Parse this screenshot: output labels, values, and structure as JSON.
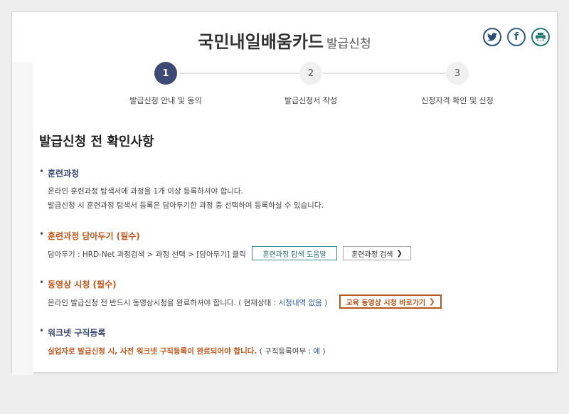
{
  "header": {
    "title": "국민내일배움카드",
    "subtitle": "발급신청"
  },
  "social": [
    "twitter-icon",
    "facebook-icon",
    "print-icon"
  ],
  "steps": [
    {
      "num": "1",
      "label": "발급신청 안내 및 동의"
    },
    {
      "num": "2",
      "label": "발급신청서 작성"
    },
    {
      "num": "3",
      "label": "신청자격 확인 및 신청"
    }
  ],
  "section": {
    "title": "발급신청 전 확인사항"
  },
  "training": {
    "head": "훈련과정",
    "line1": "온라인 훈련과정 탐색서에 과정을 1개 이상 등록하셔야 합니다.",
    "line2": "발급신청 시 훈련과정 탐색서 등록은 담아두기한 과정 중 선택하여 등록하실 수 있습니다."
  },
  "basket": {
    "head": "훈련과정 담아두기 (필수)",
    "line": "담아두기 : HRD-Net 과정검색 > 과정 선택 > [담아두기] 클릭",
    "help_button": "훈련과정 탐색 도움말",
    "search_button": "훈련과정 검색"
  },
  "video": {
    "head": "동영상 시청 (필수)",
    "line_prefix": "온라인 발급신청 전 반드시 동영상시청을 완료하셔야 합니다. ( 현재상태 : ",
    "status": "시청내역 없음",
    "line_suffix": " )",
    "button": "교육 동영상 시청 바로가기"
  },
  "worknet": {
    "head": "워크넷 구직등록",
    "warning": "실업자로 발급신청 시, 사전 워크넷 구직등록이 완료되어야 합니다.",
    "status_prefix": " ( 구직등록여부 : ",
    "status": "예",
    "status_suffix": " )"
  },
  "colors": {
    "navy": "#3d4a73",
    "orange": "#c0571b",
    "teal": "#3c8d91",
    "link_blue": "#2b5a96"
  }
}
